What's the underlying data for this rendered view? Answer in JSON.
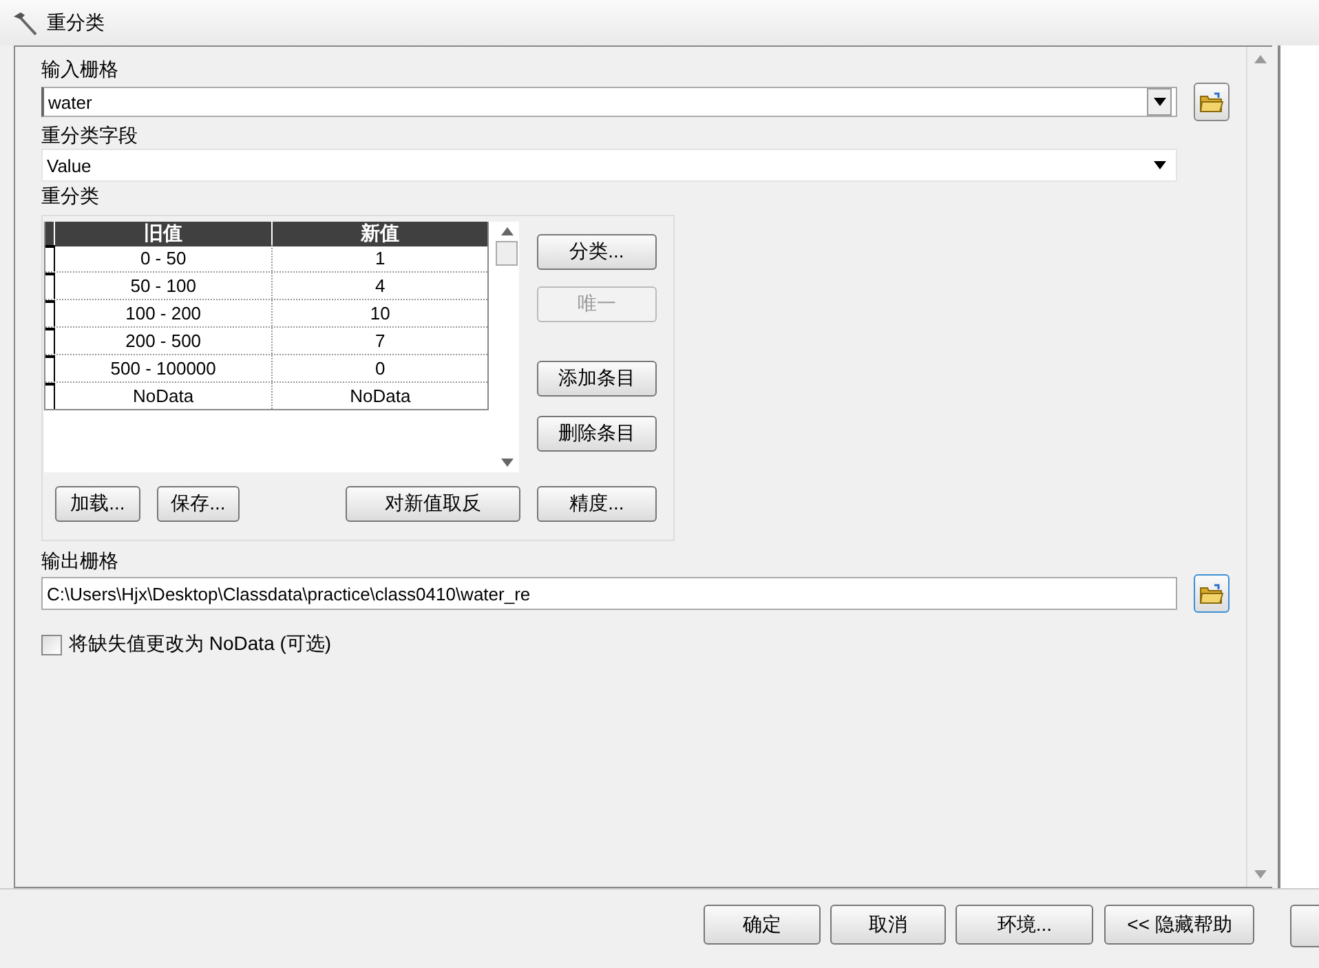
{
  "window": {
    "title": "重分类"
  },
  "input_raster": {
    "label": "输入栅格",
    "value": "water"
  },
  "reclass_field": {
    "label": "重分类字段",
    "value": "Value"
  },
  "reclassification": {
    "label": "重分类",
    "columns": [
      "旧值",
      "新值"
    ],
    "rows": [
      {
        "old": "0 - 50",
        "new": "1"
      },
      {
        "old": "50 - 100",
        "new": "4"
      },
      {
        "old": "100 - 200",
        "new": "10"
      },
      {
        "old": "200 - 500",
        "new": "7"
      },
      {
        "old": "500 - 100000",
        "new": "0"
      },
      {
        "old": "NoData",
        "new": "NoData"
      }
    ],
    "side_buttons": [
      {
        "label": "分类...",
        "disabled": false
      },
      {
        "label": "唯一",
        "disabled": true
      },
      {
        "label": "添加条目",
        "disabled": false
      },
      {
        "label": "删除条目",
        "disabled": false
      }
    ],
    "bottom_buttons": [
      "加载...",
      "保存...",
      "对新值取反",
      "精度..."
    ]
  },
  "output_raster": {
    "label": "输出栅格",
    "value": "C:\\Users\\Hjx\\Desktop\\Classdata\\practice\\class0410\\water_re"
  },
  "nodata_option": {
    "label": "将缺失值更改为 NoData (可选)",
    "checked": false
  },
  "footer_buttons": [
    "确定",
    "取消",
    "环境...",
    "<< 隐藏帮助"
  ]
}
